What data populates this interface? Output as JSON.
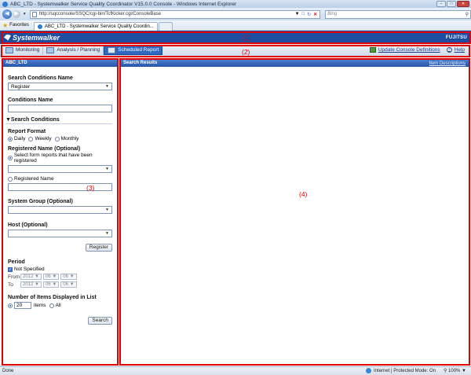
{
  "browser": {
    "window_title": "ABC_LTD - Systemwalker Service Quality Coordinator V15.0.0 Console - Windows Internet Explorer",
    "url": "http://sqcconsole/SSQC/cgi-bin/TcfKicker.cgi/ConsoleBase",
    "search_placeholder": "Bing",
    "favorites_label": "Favorites",
    "tab_title": "ABC_LTD - Systemwalker Service Quality Coordin...",
    "status_text": "Done",
    "zone_text": "Internet | Protected Mode: On",
    "zoom_text": "100%"
  },
  "app": {
    "brand": "Systemwalker",
    "vendor": "FUJITSU",
    "menu": [
      "Monitoring",
      "Analysis / Planning",
      "Scheduled Report"
    ],
    "active_menu_index": 2,
    "update_console_definitions": "Update Console Definitions",
    "help": "Help"
  },
  "annotations": [
    "(1)",
    "(2)",
    "(3)",
    "(4)"
  ],
  "left_panel": {
    "title": "ABC_LTD",
    "search_conditions_name_label": "Search Conditions Name",
    "search_conditions_name_value": "Register",
    "conditions_name_label": "Conditions Name",
    "search_conditions_section": "▼Search Conditions",
    "report_format_label": "Report Format",
    "report_formats": [
      "Daily",
      "Weekly",
      "Monthly"
    ],
    "registered_name_label": "Registered Name (Optional)",
    "registered_option_1": "Select form reports that have been registered",
    "registered_option_2": "Registered Name",
    "system_group_label": "System Group (Optional)",
    "host_label": "Host (Optional)",
    "register_button": "Register",
    "period_label": "Period",
    "not_specified": "Not Specified",
    "from_label": "From",
    "to_label": "To",
    "from_date": {
      "year": "2012",
      "month": "06",
      "day": "06"
    },
    "to_date": {
      "year": "2012",
      "month": "06",
      "day": "06"
    },
    "items_label": "Number of Items Displayed in List",
    "items_value": "20",
    "items_suffix": "items",
    "items_all": "All",
    "search_button": "Search"
  },
  "right_panel": {
    "title": "Search Results",
    "icon_link": "Item Descriptions"
  }
}
